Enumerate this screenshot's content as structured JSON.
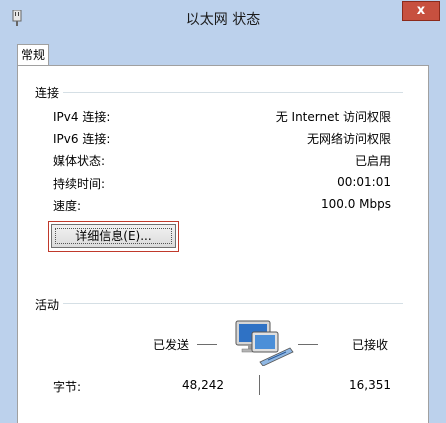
{
  "window": {
    "title": "以太网 状态",
    "close_glyph": "x"
  },
  "tabs": [
    {
      "label": "常规"
    }
  ],
  "connection": {
    "group_label": "连接",
    "rows": [
      {
        "label": "IPv4 连接:",
        "value": "无 Internet 访问权限"
      },
      {
        "label": "IPv6 连接:",
        "value": "无网络访问权限"
      },
      {
        "label": "媒体状态:",
        "value": "已启用"
      },
      {
        "label": "持续时间:",
        "value": "00:01:01"
      },
      {
        "label": "速度:",
        "value": "100.0 Mbps"
      }
    ],
    "details_button": "详细信息(E)..."
  },
  "activity": {
    "group_label": "活动",
    "sent_label": "已发送",
    "received_label": "已接收",
    "bytes_label": "字节:",
    "bytes_sent": "48,242",
    "bytes_received": "16,351"
  },
  "colors": {
    "frame": "#bcd1ec",
    "close_button": "#c7503f",
    "focus_border": "#c0392b"
  },
  "icons": {
    "title": "network-adapter-icon",
    "activity": "network-computers-icon"
  }
}
